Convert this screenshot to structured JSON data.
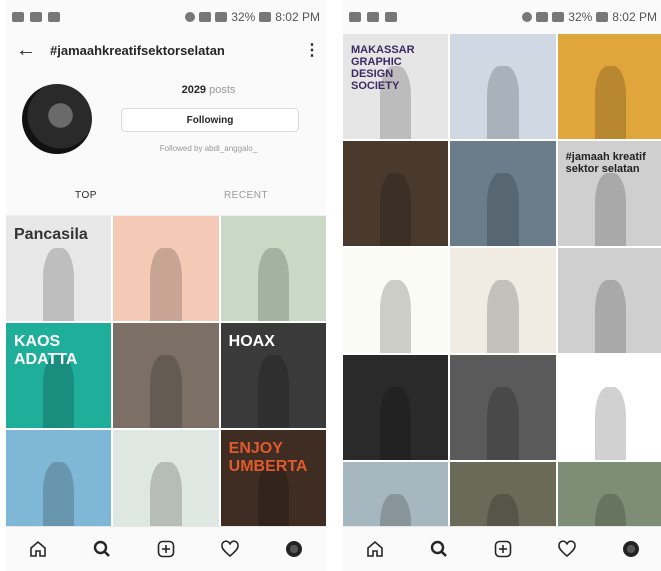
{
  "status_bar": {
    "battery": "32%",
    "time": "8:02 PM"
  },
  "left_screen": {
    "header": {
      "title": "#jamaahkreatifsektorselatan"
    },
    "profile": {
      "posts_count": "2029",
      "posts_label": "posts",
      "follow_button": "Following",
      "followed_by": "Followed by abdi_anggalo_"
    },
    "tabs": [
      {
        "label": "TOP"
      },
      {
        "label": "RECENT"
      }
    ],
    "tiles": [
      {
        "text": "Pancasila",
        "bg": "#e8e8e8",
        "fg": "#333"
      },
      {
        "text": "",
        "bg": "#f4c9b5",
        "fg": "#2b6e56"
      },
      {
        "text": "",
        "bg": "#c9d9c6",
        "fg": "#e05a2b"
      },
      {
        "text": "KAOS ADATTA",
        "bg": "#1fae9a",
        "fg": "#ffffff"
      },
      {
        "text": "",
        "bg": "#7b6f66",
        "fg": "#ddd"
      },
      {
        "text": "HOAX",
        "bg": "#3a3a3a",
        "fg": "#ffffff"
      },
      {
        "text": "",
        "bg": "#7fb8d6",
        "fg": "#f1d9a8"
      },
      {
        "text": "",
        "bg": "#dfe7e2",
        "fg": "#333"
      },
      {
        "text": "ENJOY UMBERTA",
        "bg": "#3f2c22",
        "fg": "#e05a2b"
      }
    ]
  },
  "right_screen": {
    "tiles": [
      {
        "text": "MAKASSAR GRAPHIC DESIGN SOCIETY",
        "bg": "#e6e6e6",
        "fg": "#3a2b63"
      },
      {
        "text": "",
        "bg": "#cfd8e3",
        "fg": "#333"
      },
      {
        "text": "",
        "bg": "#e0a63b",
        "fg": "#333"
      },
      {
        "text": "",
        "bg": "#4a3a2e",
        "fg": "#ddd"
      },
      {
        "text": "",
        "bg": "#6b7d8a",
        "fg": "#fff"
      },
      {
        "text": "#jamaah kreatif sektor selatan",
        "bg": "#cfcfcf",
        "fg": "#222"
      },
      {
        "text": "",
        "bg": "#fbfbf5",
        "fg": "#d33"
      },
      {
        "text": "",
        "bg": "#f0ece4",
        "fg": "#b3263a"
      },
      {
        "text": "",
        "bg": "#cfcfcf",
        "fg": "#333"
      },
      {
        "text": "",
        "bg": "#2a2a2a",
        "fg": "#ddd"
      },
      {
        "text": "",
        "bg": "#5a5a5a",
        "fg": "#ddd"
      },
      {
        "text": "",
        "bg": "#ffffff",
        "fg": "#111"
      },
      {
        "text": "",
        "bg": "#a6b7bf",
        "fg": "#333"
      },
      {
        "text": "",
        "bg": "#6a6a58",
        "fg": "#d9c44a"
      },
      {
        "text": "",
        "bg": "#7e8e76",
        "fg": "#333"
      }
    ]
  },
  "nav_icons": [
    "home-icon",
    "search-icon",
    "add-icon",
    "heart-icon",
    "profile-avatar"
  ]
}
